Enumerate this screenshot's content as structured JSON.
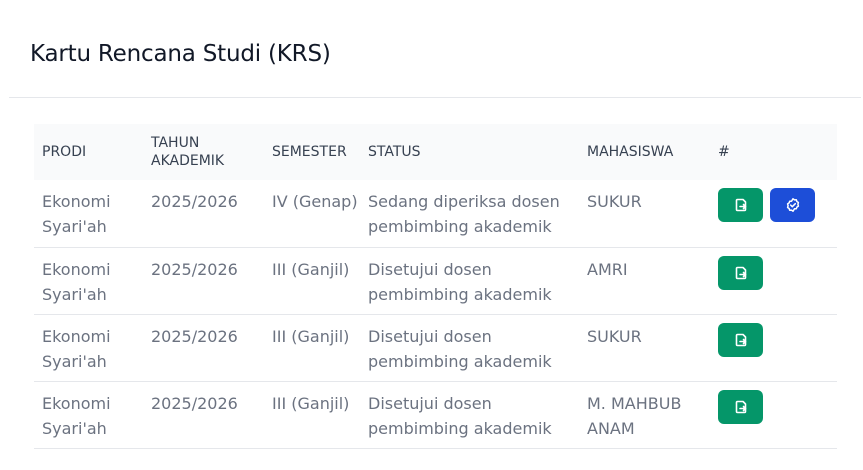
{
  "page": {
    "title": "Kartu Rencana Studi (KRS)"
  },
  "table": {
    "headers": {
      "prodi": "PRODI",
      "tahun": "TAHUN AKADEMIK",
      "semester": "SEMESTER",
      "status": "STATUS",
      "mahasiswa": "MAHASISWA",
      "actions": "#"
    },
    "rows": [
      {
        "prodi": "Ekonomi Syari'ah",
        "tahun": "2025/2026",
        "semester": "IV (Genap)",
        "status": "Sedang diperiksa dosen pembimbing akademik",
        "mahasiswa": "SUKUR",
        "actions": [
          "open-icon",
          "check-badge-icon"
        ]
      },
      {
        "prodi": "Ekonomi Syari'ah",
        "tahun": "2025/2026",
        "semester": "III (Ganjil)",
        "status": "Disetujui dosen pembimbing akademik",
        "mahasiswa": "AMRI",
        "actions": [
          "open-icon"
        ]
      },
      {
        "prodi": "Ekonomi Syari'ah",
        "tahun": "2025/2026",
        "semester": "III (Ganjil)",
        "status": "Disetujui dosen pembimbing akademik",
        "mahasiswa": "SUKUR",
        "actions": [
          "open-icon"
        ]
      },
      {
        "prodi": "Ekonomi Syari'ah",
        "tahun": "2025/2026",
        "semester": "III (Ganjil)",
        "status": "Disetujui dosen pembimbing akademik",
        "mahasiswa": "M. MAHBUB ANAM",
        "actions": [
          "open-icon"
        ]
      }
    ]
  },
  "colors": {
    "green_button": "#059669",
    "blue_button": "#1d4ed8",
    "header_bg": "#f9fafb",
    "text_muted": "#6b7280"
  }
}
